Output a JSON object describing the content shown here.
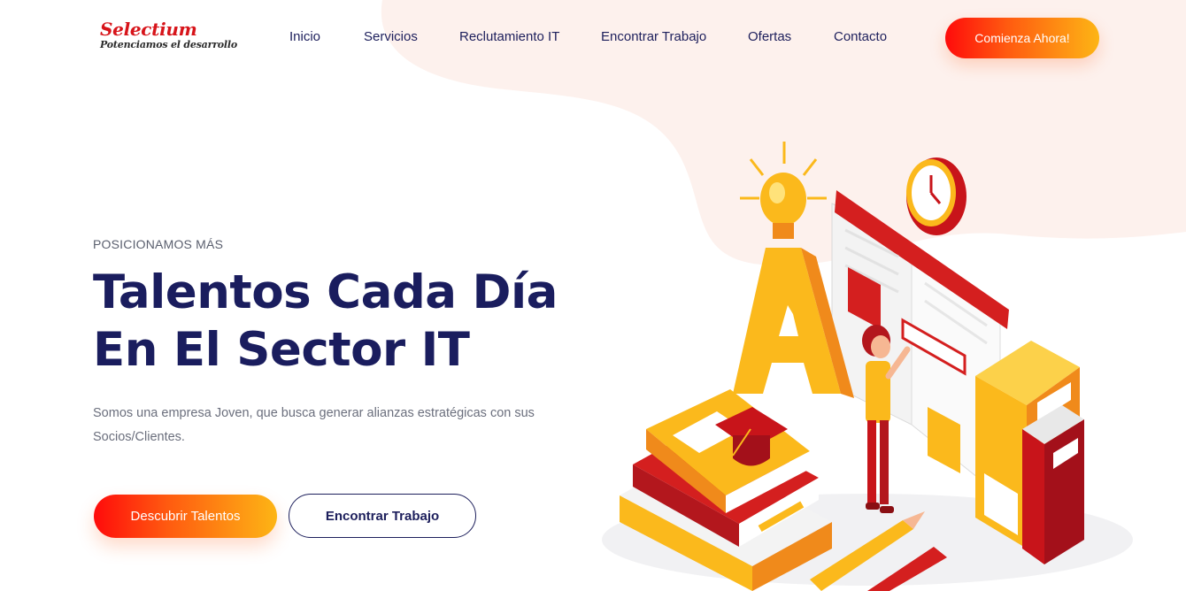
{
  "brand": {
    "name": "Selectium",
    "tagline": "Potenciamos el desarrollo"
  },
  "nav": {
    "items": [
      {
        "label": "Inicio"
      },
      {
        "label": "Servicios"
      },
      {
        "label": "Reclutamiento IT"
      },
      {
        "label": "Encontrar Trabajo"
      },
      {
        "label": "Ofertas"
      },
      {
        "label": "Contacto"
      }
    ],
    "cta_label": "Comienza Ahora!"
  },
  "hero": {
    "eyebrow": "POSICIONAMOS MÁS",
    "title_line1": "Talentos Cada Día",
    "title_line2": "En El Sector IT",
    "description_line1": "Somos una empresa Joven, que busca generar alianzas estratégicas con sus",
    "description_line2": "Socios/Clientes.",
    "primary_button": "Descubrir Talentos",
    "secondary_button": "Encontrar Trabajo",
    "illustration_text": "A"
  },
  "colors": {
    "brand_red": "#d7141a",
    "navy": "#1a1d5e",
    "gradient_start": "#ff0b0b",
    "gradient_end": "#fdb515",
    "blob": "#fdf2ef"
  }
}
